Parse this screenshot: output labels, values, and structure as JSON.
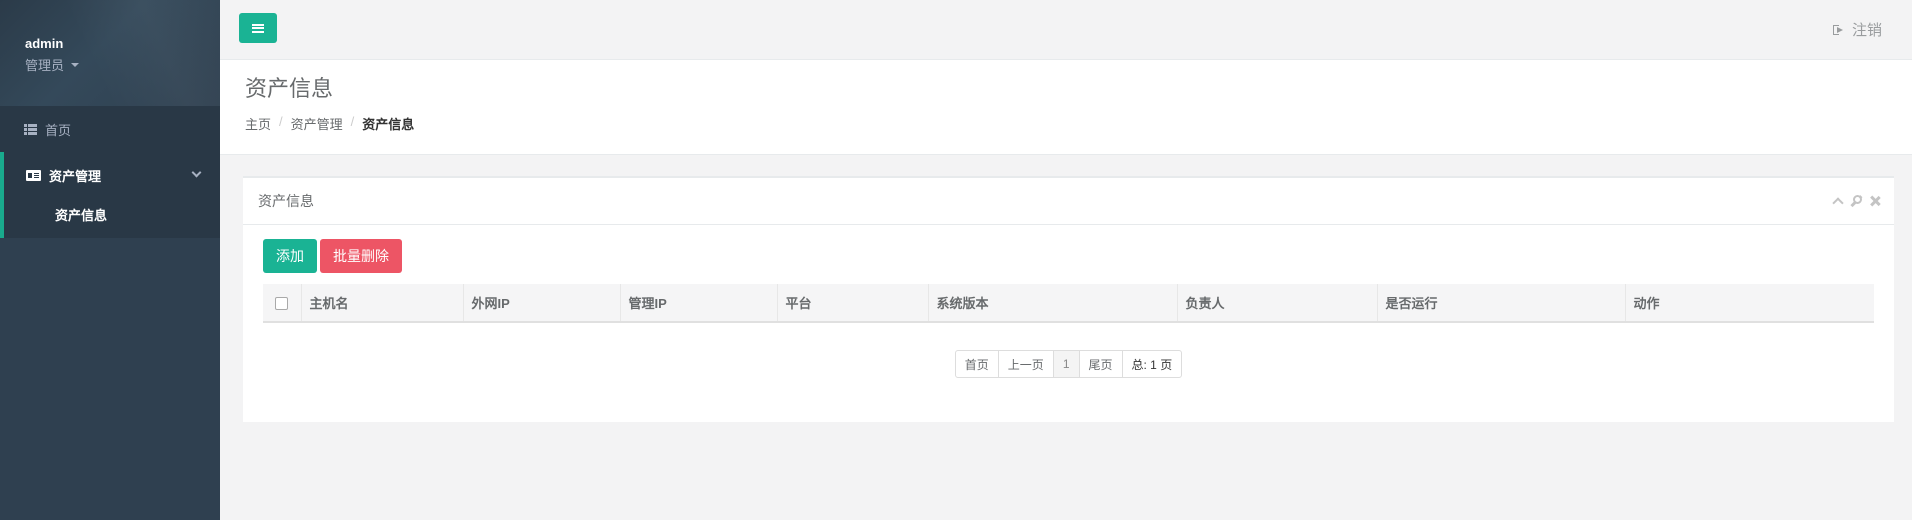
{
  "user": {
    "name": "admin",
    "role": "管理员"
  },
  "sidebar": {
    "items": [
      {
        "label": "首页",
        "icon": "list-icon"
      },
      {
        "label": "资产管理",
        "icon": "id-card-icon",
        "children": [
          {
            "label": "资产信息"
          }
        ]
      }
    ]
  },
  "topbar": {
    "logout_label": "注销"
  },
  "page": {
    "title": "资产信息",
    "breadcrumb": [
      "主页",
      "资产管理",
      "资产信息"
    ]
  },
  "panel": {
    "title": "资产信息",
    "add_label": "添加",
    "batch_delete_label": "批量删除",
    "columns": [
      "主机名",
      "外网IP",
      "管理IP",
      "平台",
      "系统版本",
      "负责人",
      "是否运行",
      "动作"
    ]
  },
  "pagination": {
    "first": "首页",
    "prev": "上一页",
    "current": "1",
    "last": "尾页",
    "total": "总: 1 页"
  },
  "colors": {
    "sidebar": "#2f4050",
    "accent": "#1ab394",
    "danger": "#ed5565"
  }
}
